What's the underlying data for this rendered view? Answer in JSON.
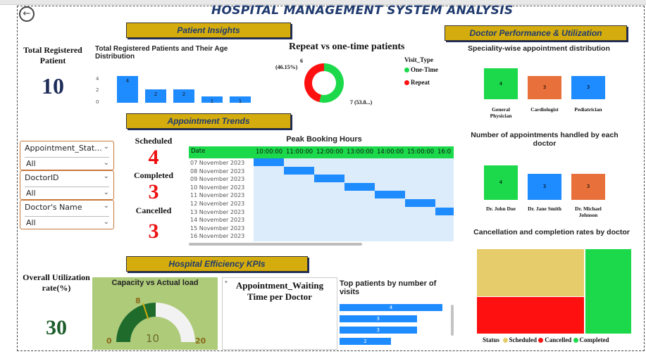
{
  "colors": {
    "blue": "#1e8bff",
    "green": "#1bd94a",
    "orange": "#e8703a",
    "red": "#ff1010",
    "gold": "#d4ac0d",
    "tan": "#e6cc6a"
  },
  "title": "HOSPITAL MANAGEMENT SYSTEM ANALYSIS",
  "banners": {
    "patient_insights": "Patient Insights",
    "doctor_perf": "Doctor Performance & Utilization",
    "appointment_trends": "Appointment Trends",
    "hospital_kpis": "Hospital Efficiency KPIs"
  },
  "kpi_total": {
    "label": "Total Registered Patient",
    "value": "10"
  },
  "age_chart": {
    "title": "Total Registered Patients and Their Age Distribution",
    "yticks": [
      "4",
      "2",
      "0"
    ],
    "bars": [
      4,
      2,
      2,
      1,
      1
    ]
  },
  "repeat_chart": {
    "title": "Repeat vs one-time patients",
    "left_value": "6",
    "left_pct": "(46.15%)",
    "right_label": "7 (53.8...)",
    "legend_title": "Visit_Type",
    "legend": [
      "One-Time",
      "Repeat"
    ],
    "split": [
      0.4615,
      0.5385
    ]
  },
  "specialty": {
    "title": "Speciality-wise appointment distribution",
    "items": [
      {
        "label": "General Physician",
        "value": "4"
      },
      {
        "label": "Cardiologist",
        "value": "3"
      },
      {
        "label": "Pediatrician",
        "value": "3"
      }
    ]
  },
  "doctor_appts": {
    "title": "Number of appointments handled by each doctor",
    "items": [
      {
        "label": "Dr. John Doe",
        "value": "4"
      },
      {
        "label": "Dr. Jane Smith",
        "value": "3"
      },
      {
        "label": "Dr. Michael Johnson",
        "value": "3"
      }
    ]
  },
  "cancel_chart": {
    "title": "Cancellation and completion rates by doctor",
    "legend_title": "Status",
    "legend": [
      "Scheduled",
      "Cancelled",
      "Completed"
    ]
  },
  "status_counts": [
    {
      "label": "Scheduled",
      "value": "4"
    },
    {
      "label": "Completed",
      "value": "3"
    },
    {
      "label": "Cancelled",
      "value": "3"
    }
  ],
  "slicers": [
    {
      "label": "Appointment_Stat...",
      "value": "All"
    },
    {
      "label": "DoctorID",
      "value": "All"
    },
    {
      "label": "Doctor's Name",
      "value": "All"
    }
  ],
  "peak": {
    "title": "Peak Booking Hours",
    "header_date": "Date",
    "hours": [
      "10:00:00",
      "11:00:00",
      "12:00:00",
      "13:00:00",
      "14:00:00",
      "15:00:00",
      "16:0"
    ],
    "dates": [
      "07 November 2023",
      "08 November 2023",
      "09 November 2023",
      "10 November 2023",
      "11 November 2023",
      "12 November 2023",
      "13 November 2023",
      "14 November 2023",
      "15 November 2023",
      "16 November 2023"
    ],
    "slots": [
      0,
      1,
      2,
      3,
      4,
      5,
      6
    ]
  },
  "utilization": {
    "label": "Overall Utilization rate(%)",
    "value": "30"
  },
  "gauge": {
    "title": "Capacity vs Actual load",
    "min": "0",
    "max": "20",
    "target": "8",
    "value": "10"
  },
  "waiting": {
    "title": "Appointment_Waiting Time per Doctor"
  },
  "top_patients": {
    "title": "Top patients by number of visits",
    "values": [
      "4",
      "3",
      "3",
      "2"
    ]
  }
}
